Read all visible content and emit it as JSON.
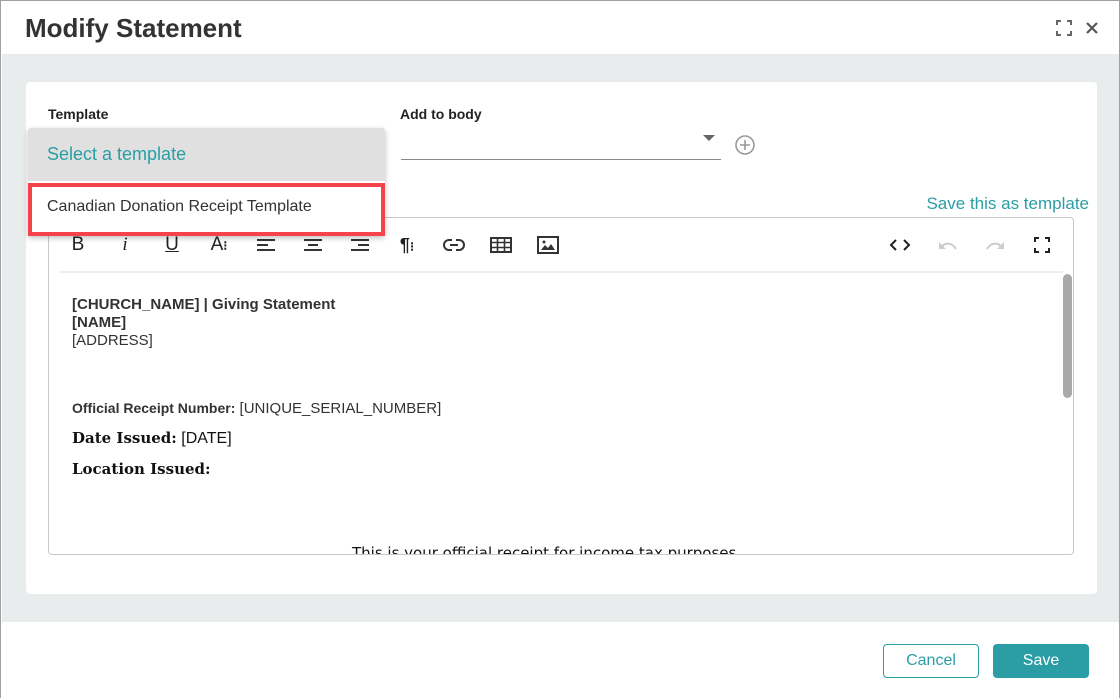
{
  "dialog": {
    "title": "Modify Statement",
    "icons": {
      "maximize": "maximize-icon",
      "close": "close-icon"
    }
  },
  "form": {
    "template_label": "Template",
    "template_select": {
      "selected": "Select a template",
      "options": [
        "Canadian Donation Receipt Template"
      ],
      "highlighted_option": "Canadian Donation Receipt Template"
    },
    "add_to_body_label": "Add to body",
    "add_to_body_value": "",
    "save_as_template_link": "Save this as template"
  },
  "editor": {
    "toolbar": [
      {
        "name": "bold",
        "glyph": "B"
      },
      {
        "name": "italic",
        "glyph": "i"
      },
      {
        "name": "underline",
        "glyph": "U"
      },
      {
        "name": "font-size",
        "glyph": "A:"
      },
      {
        "name": "align-left",
        "glyph": "align-left"
      },
      {
        "name": "align-center",
        "glyph": "align-center"
      },
      {
        "name": "align-right",
        "glyph": "align-right"
      },
      {
        "name": "paragraph-format",
        "glyph": "¶:"
      },
      {
        "name": "link",
        "glyph": "link"
      },
      {
        "name": "table",
        "glyph": "table"
      },
      {
        "name": "image",
        "glyph": "image"
      },
      {
        "name": "code-view",
        "glyph": "<>"
      },
      {
        "name": "undo",
        "glyph": "undo"
      },
      {
        "name": "redo",
        "glyph": "redo"
      },
      {
        "name": "fullscreen",
        "glyph": "fullscreen"
      }
    ],
    "content": {
      "line1": "[CHURCH_NAME] | Giving Statement",
      "line2": "[NAME]",
      "line3": "[ADDRESS]",
      "receipt_label": "Official Receipt Number:",
      "receipt_value": " [UNIQUE_SERIAL_NUMBER]",
      "date_label": "Date Issued:",
      "date_value": " [DATE]",
      "location_label": "Location Issued:",
      "footer_note": "This is your official receipt for income tax purposes."
    }
  },
  "footer": {
    "cancel_label": "Cancel",
    "save_label": "Save"
  },
  "colors": {
    "accent": "#2a9ea5",
    "highlight_border": "#f4434a",
    "background": "#e9eced"
  }
}
